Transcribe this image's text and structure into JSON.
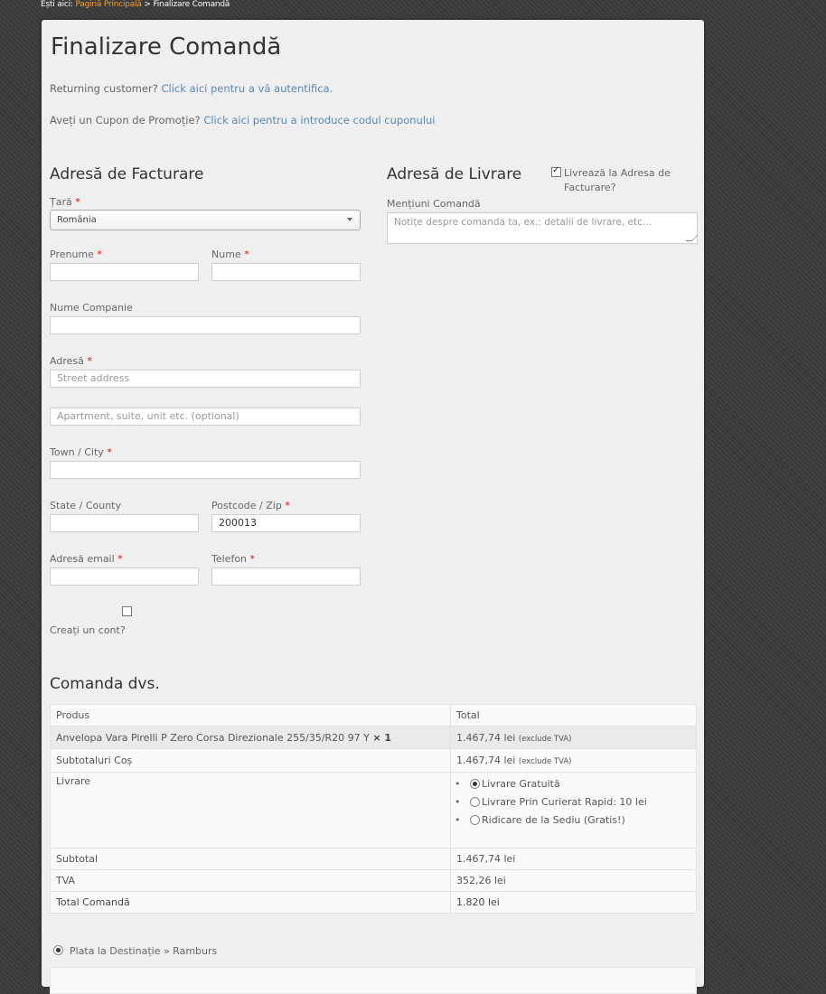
{
  "breadcrumb": {
    "prefix": "Ești aici:",
    "home": "Pagină Principală",
    "separator": ">",
    "current": "Finalizare Comandă"
  },
  "page": {
    "title": "Finalizare Comandă"
  },
  "notices": {
    "login_text": "Returning customer?",
    "login_link": "Click aici pentru a vă autentifica.",
    "coupon_text": "Aveți un Cupon de Promoție?",
    "coupon_link": "Click aici pentru a introduce codul cuponului"
  },
  "billing": {
    "heading": "Adresă de Facturare",
    "country_label": "Țară",
    "country_value": "România",
    "first_name_label": "Prenume",
    "last_name_label": "Nume",
    "company_label": "Nume Companie",
    "address_label": "Adresă",
    "address1_placeholder": "Street address",
    "address2_placeholder": "Apartment, suite, unit etc. (optional)",
    "city_label": "Town / City",
    "state_label": "State / County",
    "postcode_label": "Postcode / Zip",
    "postcode_value": "200013",
    "email_label": "Adresă email",
    "phone_label": "Telefon",
    "create_account_label": "Creați un cont?",
    "required_mark": "*"
  },
  "shipping": {
    "heading": "Adresă de Livrare",
    "same_address_label_1": "Livrează la Adresa de",
    "same_address_label_2": "Facturare?",
    "same_address_checked": true,
    "notes_label": "Mențiuni Comandă",
    "notes_placeholder": "Notițe despre comanda ta, ex.: detalii de livrare, etc..."
  },
  "order": {
    "heading": "Comanda dvs.",
    "col_product": "Produs",
    "col_total": "Total",
    "item_name": "Anvelopa Vara Pirelli P Zero Corsa Direzionale 255/35/R20 97 Y",
    "item_qty": "× 1",
    "item_total": "1.467,74 lei",
    "excl_vat": "(exclude TVA)",
    "cart_subtotal_label": "Subtotaluri Coș",
    "cart_subtotal_value": "1.467,74 lei",
    "shipping_label": "Livrare",
    "shipping_options": [
      "Livrare Gratuită",
      "Livrare Prin Curierat Rapid: 10 lei",
      "Ridicare de la Sediu (Gratis!)"
    ],
    "shipping_selected": 0,
    "subtotal_label": "Subtotal",
    "subtotal_value": "1.467,74 lei",
    "vat_label": "TVA",
    "vat_value": "352,26 lei",
    "total_label": "Total Comandă",
    "total_value": "1.820 lei"
  },
  "payment": {
    "method_label": "Plata la Destinație » Ramburs",
    "selected": true
  }
}
